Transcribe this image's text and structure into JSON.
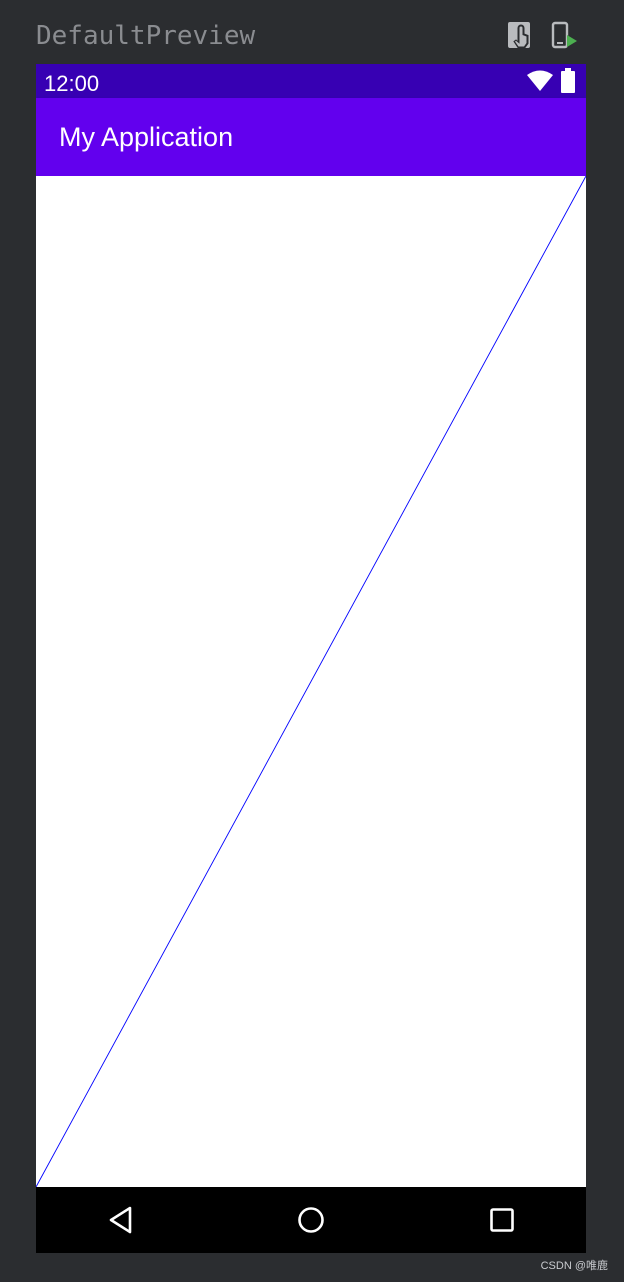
{
  "ide": {
    "preview_name": "DefaultPreview",
    "toolbar": {
      "interactive_mode_icon": "touch-hand-icon",
      "deploy_preview_icon": "device-run-icon",
      "deploy_accent": "#4caf50"
    }
  },
  "device": {
    "status_bar": {
      "time": "12:00",
      "color": "#3700b3",
      "icons": [
        "wifi-icon",
        "battery-icon"
      ]
    },
    "app_bar": {
      "title": "My Application",
      "color": "#6200ee"
    },
    "canvas": {
      "background": "#ffffff",
      "line_color": "#0000ff",
      "line": "diagonal from bottom-left to top-right"
    },
    "nav_bar": {
      "color": "#000000",
      "buttons": [
        "back-icon",
        "home-icon",
        "recents-icon"
      ]
    }
  },
  "watermark": "CSDN @唯鹿"
}
